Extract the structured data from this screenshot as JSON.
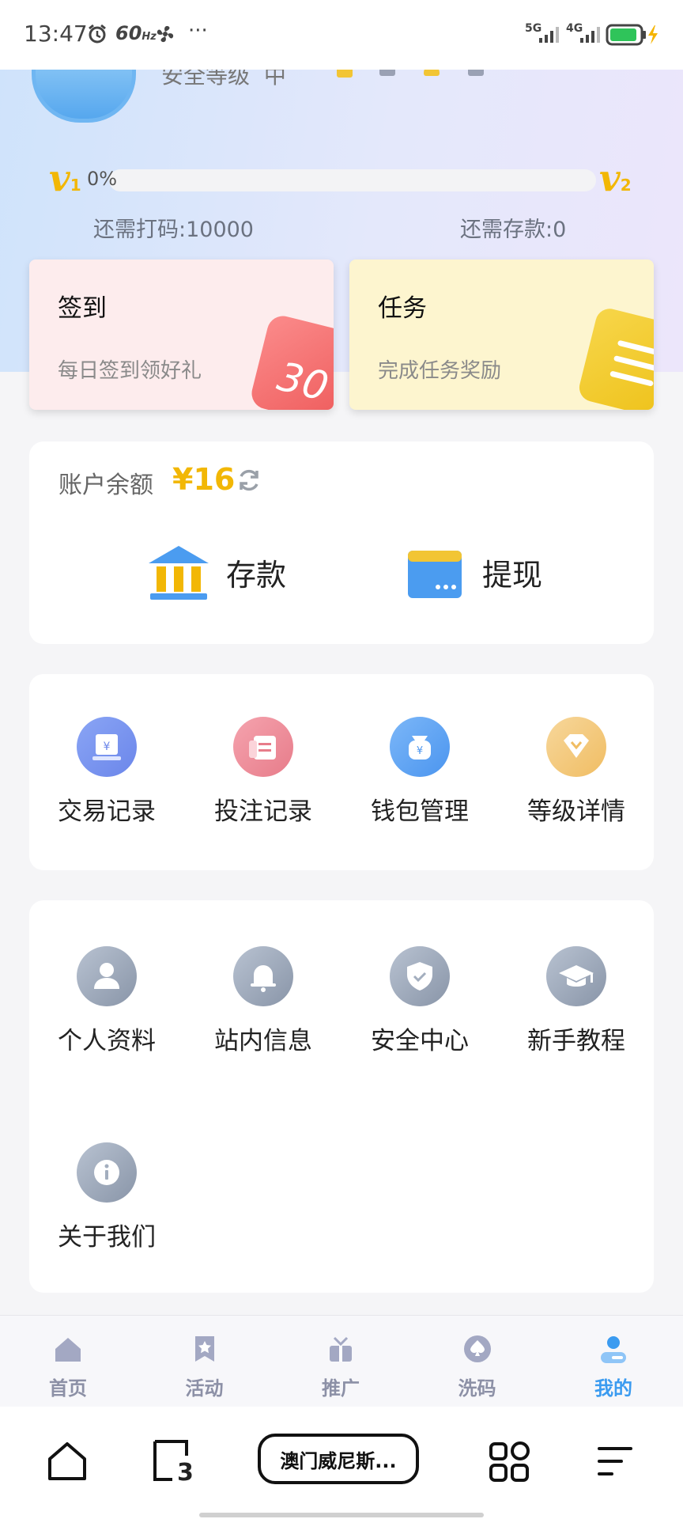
{
  "status_bar": {
    "time": "13:47",
    "refresh_rate": "60",
    "refresh_unit": "Hz",
    "more": "···",
    "net1": "5G",
    "net2": "4G"
  },
  "profile": {
    "security_label": "安全等级",
    "security_level": "中"
  },
  "vip": {
    "current_level": "1",
    "next_level": "2",
    "progress_text": "0%",
    "progress": 0,
    "need_bet": "还需打码:10000",
    "need_deposit": "还需存款:0"
  },
  "cards": {
    "checkin_title": "签到",
    "checkin_sub": "每日签到领好礼",
    "checkin_icon_number": "30",
    "task_title": "任务",
    "task_sub": "完成任务奖励"
  },
  "balance": {
    "label": "账户余额",
    "value": "¥16",
    "deposit_label": "存款",
    "withdraw_label": "提现"
  },
  "records": [
    {
      "label": "交易记录",
      "icon": "transaction-icon"
    },
    {
      "label": "投注记录",
      "icon": "bet-record-icon"
    },
    {
      "label": "钱包管理",
      "icon": "wallet-icon"
    },
    {
      "label": "等级详情",
      "icon": "diamond-icon"
    }
  ],
  "services": [
    {
      "label": "个人资料",
      "icon": "user-icon"
    },
    {
      "label": "站内信息",
      "icon": "bell-icon"
    },
    {
      "label": "安全中心",
      "icon": "shield-icon"
    },
    {
      "label": "新手教程",
      "icon": "graduation-cap-icon"
    },
    {
      "label": "关于我们",
      "icon": "info-icon"
    }
  ],
  "tabbar": [
    {
      "label": "首页",
      "icon": "home-icon",
      "active": false
    },
    {
      "label": "活动",
      "icon": "star-bookmark-icon",
      "active": false
    },
    {
      "label": "推广",
      "icon": "gift-icon",
      "active": false
    },
    {
      "label": "洗码",
      "icon": "spade-icon",
      "active": false
    },
    {
      "label": "我的",
      "icon": "profile-icon",
      "active": true
    }
  ],
  "system_nav": {
    "tab_count": "3",
    "current_app": "澳门威尼斯..."
  },
  "colors": {
    "accent_gold": "#f2b705",
    "active_blue": "#3b9bf0",
    "checkin_bg": "#fdeced",
    "task_bg": "#fdf5cf"
  }
}
